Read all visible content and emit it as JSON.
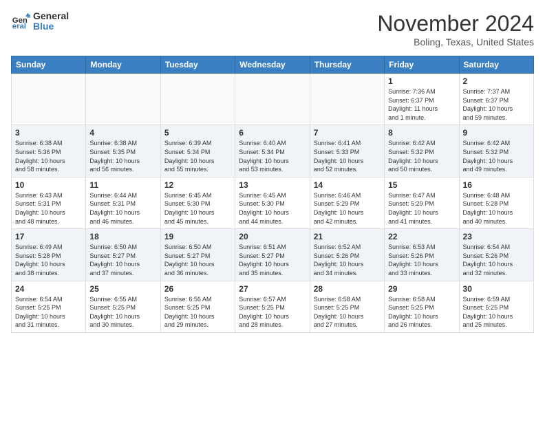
{
  "logo": {
    "general": "General",
    "blue": "Blue"
  },
  "header": {
    "month": "November 2024",
    "location": "Boling, Texas, United States"
  },
  "weekdays": [
    "Sunday",
    "Monday",
    "Tuesday",
    "Wednesday",
    "Thursday",
    "Friday",
    "Saturday"
  ],
  "weeks": [
    [
      {
        "day": "",
        "info": ""
      },
      {
        "day": "",
        "info": ""
      },
      {
        "day": "",
        "info": ""
      },
      {
        "day": "",
        "info": ""
      },
      {
        "day": "",
        "info": ""
      },
      {
        "day": "1",
        "info": "Sunrise: 7:36 AM\nSunset: 6:37 PM\nDaylight: 11 hours\nand 1 minute."
      },
      {
        "day": "2",
        "info": "Sunrise: 7:37 AM\nSunset: 6:37 PM\nDaylight: 10 hours\nand 59 minutes."
      }
    ],
    [
      {
        "day": "3",
        "info": "Sunrise: 6:38 AM\nSunset: 5:36 PM\nDaylight: 10 hours\nand 58 minutes."
      },
      {
        "day": "4",
        "info": "Sunrise: 6:38 AM\nSunset: 5:35 PM\nDaylight: 10 hours\nand 56 minutes."
      },
      {
        "day": "5",
        "info": "Sunrise: 6:39 AM\nSunset: 5:34 PM\nDaylight: 10 hours\nand 55 minutes."
      },
      {
        "day": "6",
        "info": "Sunrise: 6:40 AM\nSunset: 5:34 PM\nDaylight: 10 hours\nand 53 minutes."
      },
      {
        "day": "7",
        "info": "Sunrise: 6:41 AM\nSunset: 5:33 PM\nDaylight: 10 hours\nand 52 minutes."
      },
      {
        "day": "8",
        "info": "Sunrise: 6:42 AM\nSunset: 5:32 PM\nDaylight: 10 hours\nand 50 minutes."
      },
      {
        "day": "9",
        "info": "Sunrise: 6:42 AM\nSunset: 5:32 PM\nDaylight: 10 hours\nand 49 minutes."
      }
    ],
    [
      {
        "day": "10",
        "info": "Sunrise: 6:43 AM\nSunset: 5:31 PM\nDaylight: 10 hours\nand 48 minutes."
      },
      {
        "day": "11",
        "info": "Sunrise: 6:44 AM\nSunset: 5:31 PM\nDaylight: 10 hours\nand 46 minutes."
      },
      {
        "day": "12",
        "info": "Sunrise: 6:45 AM\nSunset: 5:30 PM\nDaylight: 10 hours\nand 45 minutes."
      },
      {
        "day": "13",
        "info": "Sunrise: 6:45 AM\nSunset: 5:30 PM\nDaylight: 10 hours\nand 44 minutes."
      },
      {
        "day": "14",
        "info": "Sunrise: 6:46 AM\nSunset: 5:29 PM\nDaylight: 10 hours\nand 42 minutes."
      },
      {
        "day": "15",
        "info": "Sunrise: 6:47 AM\nSunset: 5:29 PM\nDaylight: 10 hours\nand 41 minutes."
      },
      {
        "day": "16",
        "info": "Sunrise: 6:48 AM\nSunset: 5:28 PM\nDaylight: 10 hours\nand 40 minutes."
      }
    ],
    [
      {
        "day": "17",
        "info": "Sunrise: 6:49 AM\nSunset: 5:28 PM\nDaylight: 10 hours\nand 38 minutes."
      },
      {
        "day": "18",
        "info": "Sunrise: 6:50 AM\nSunset: 5:27 PM\nDaylight: 10 hours\nand 37 minutes."
      },
      {
        "day": "19",
        "info": "Sunrise: 6:50 AM\nSunset: 5:27 PM\nDaylight: 10 hours\nand 36 minutes."
      },
      {
        "day": "20",
        "info": "Sunrise: 6:51 AM\nSunset: 5:27 PM\nDaylight: 10 hours\nand 35 minutes."
      },
      {
        "day": "21",
        "info": "Sunrise: 6:52 AM\nSunset: 5:26 PM\nDaylight: 10 hours\nand 34 minutes."
      },
      {
        "day": "22",
        "info": "Sunrise: 6:53 AM\nSunset: 5:26 PM\nDaylight: 10 hours\nand 33 minutes."
      },
      {
        "day": "23",
        "info": "Sunrise: 6:54 AM\nSunset: 5:26 PM\nDaylight: 10 hours\nand 32 minutes."
      }
    ],
    [
      {
        "day": "24",
        "info": "Sunrise: 6:54 AM\nSunset: 5:25 PM\nDaylight: 10 hours\nand 31 minutes."
      },
      {
        "day": "25",
        "info": "Sunrise: 6:55 AM\nSunset: 5:25 PM\nDaylight: 10 hours\nand 30 minutes."
      },
      {
        "day": "26",
        "info": "Sunrise: 6:56 AM\nSunset: 5:25 PM\nDaylight: 10 hours\nand 29 minutes."
      },
      {
        "day": "27",
        "info": "Sunrise: 6:57 AM\nSunset: 5:25 PM\nDaylight: 10 hours\nand 28 minutes."
      },
      {
        "day": "28",
        "info": "Sunrise: 6:58 AM\nSunset: 5:25 PM\nDaylight: 10 hours\nand 27 minutes."
      },
      {
        "day": "29",
        "info": "Sunrise: 6:58 AM\nSunset: 5:25 PM\nDaylight: 10 hours\nand 26 minutes."
      },
      {
        "day": "30",
        "info": "Sunrise: 6:59 AM\nSunset: 5:25 PM\nDaylight: 10 hours\nand 25 minutes."
      }
    ]
  ]
}
